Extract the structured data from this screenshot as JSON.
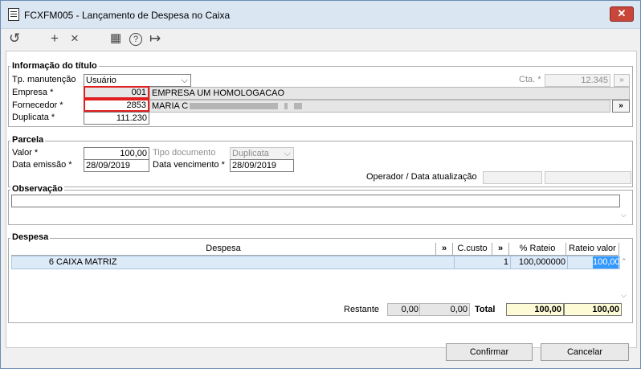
{
  "window": {
    "title": "FCXFM005 - Lançamento de Despesa no Caixa",
    "close_glyph": "✕"
  },
  "toolbar": {
    "refresh_glyph": "↺",
    "add_glyph": "+",
    "delete_glyph": "×",
    "calendar_glyph": "▦",
    "help_glyph": "?",
    "exit_glyph": "↦"
  },
  "titulo": {
    "section_label": "Informação do título",
    "tp_manutencao_label": "Tp. manutenção",
    "tp_manutencao_value": "Usuário",
    "cta_label": "Cta. *",
    "cta_value": "12.345",
    "empresa_label": "Empresa *",
    "empresa_code": "001",
    "empresa_name": "EMPRESA UM HOMOLOGACAO",
    "fornecedor_label": "Fornecedor *",
    "fornecedor_code": "2853",
    "fornecedor_name": "MARIA C",
    "duplicata_label": "Duplicata *",
    "duplicata_value": "111.230",
    "more_glyph": "»"
  },
  "parcela": {
    "section_label": "Parcela",
    "valor_label": "Valor *",
    "valor_value": "100,00",
    "tipo_doc_label": "Tipo documento",
    "tipo_doc_value": "Duplicata",
    "data_emissao_label": "Data emissão *",
    "data_emissao_value": "28/09/2019",
    "data_venc_label": "Data vencimento *",
    "data_venc_value": "28/09/2019",
    "operador_label": "Operador / Data atualização"
  },
  "observacao": {
    "section_label": "Observação"
  },
  "despesa": {
    "section_label": "Despesa",
    "columns": [
      "Despesa",
      "»",
      "C.custo",
      "»",
      "% Rateio",
      "Rateio valor"
    ],
    "rows": [
      {
        "code": "6",
        "despesa": "CAIXA MATRIZ",
        "ccusto": "1",
        "rateio_pct": "100,000000",
        "rateio_valor": "100,00"
      }
    ],
    "restante_label": "Restante",
    "restante_1": "0,00",
    "restante_2": "0,00",
    "total_label": "Total",
    "total_pct": "100,00",
    "total_valor": "100,00"
  },
  "footer": {
    "confirmar_label": "Confirmar",
    "cancelar_label": "Cancelar"
  }
}
